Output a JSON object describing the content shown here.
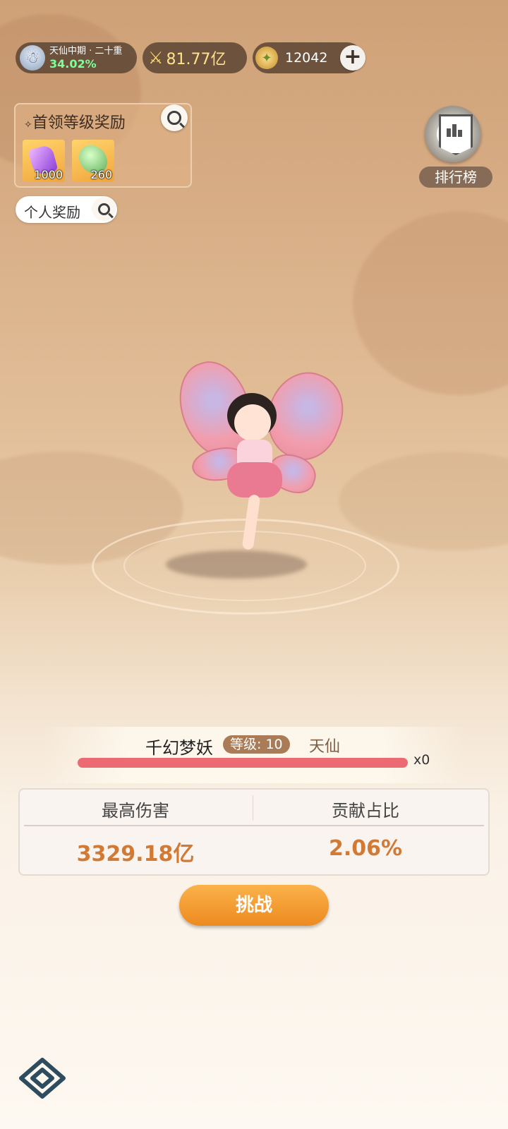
{
  "top_bar": {
    "realm_name": "天仙中期 · 二十重",
    "realm_progress": "34.02%",
    "combat_power": "81.77亿",
    "currency_amount": "12042"
  },
  "boss_reward_panel": {
    "title": "首领等级奖励",
    "items": [
      {
        "icon": "purple-crystal-icon",
        "quantity": "1000"
      },
      {
        "icon": "green-dragon-icon",
        "quantity": "260"
      }
    ]
  },
  "personal_reward_label": "个人奖励",
  "ranking_label": "排行榜",
  "boss": {
    "name": "千幻梦妖",
    "level_label": "等级: 10",
    "realm": "天仙",
    "hp_multiplier": "x0",
    "hp_fraction": 1.0
  },
  "stats": {
    "max_damage_label": "最高伤害",
    "max_damage_value": "3329.18亿",
    "contribution_label": "贡献占比",
    "contribution_value": "2.06%"
  },
  "challenge_label": "挑战",
  "colors": {
    "hp_bar": "#ec6a72",
    "stat_value": "#d17a35",
    "challenge_button": "#f29a2e",
    "realm_progress": "#7dff9a"
  }
}
